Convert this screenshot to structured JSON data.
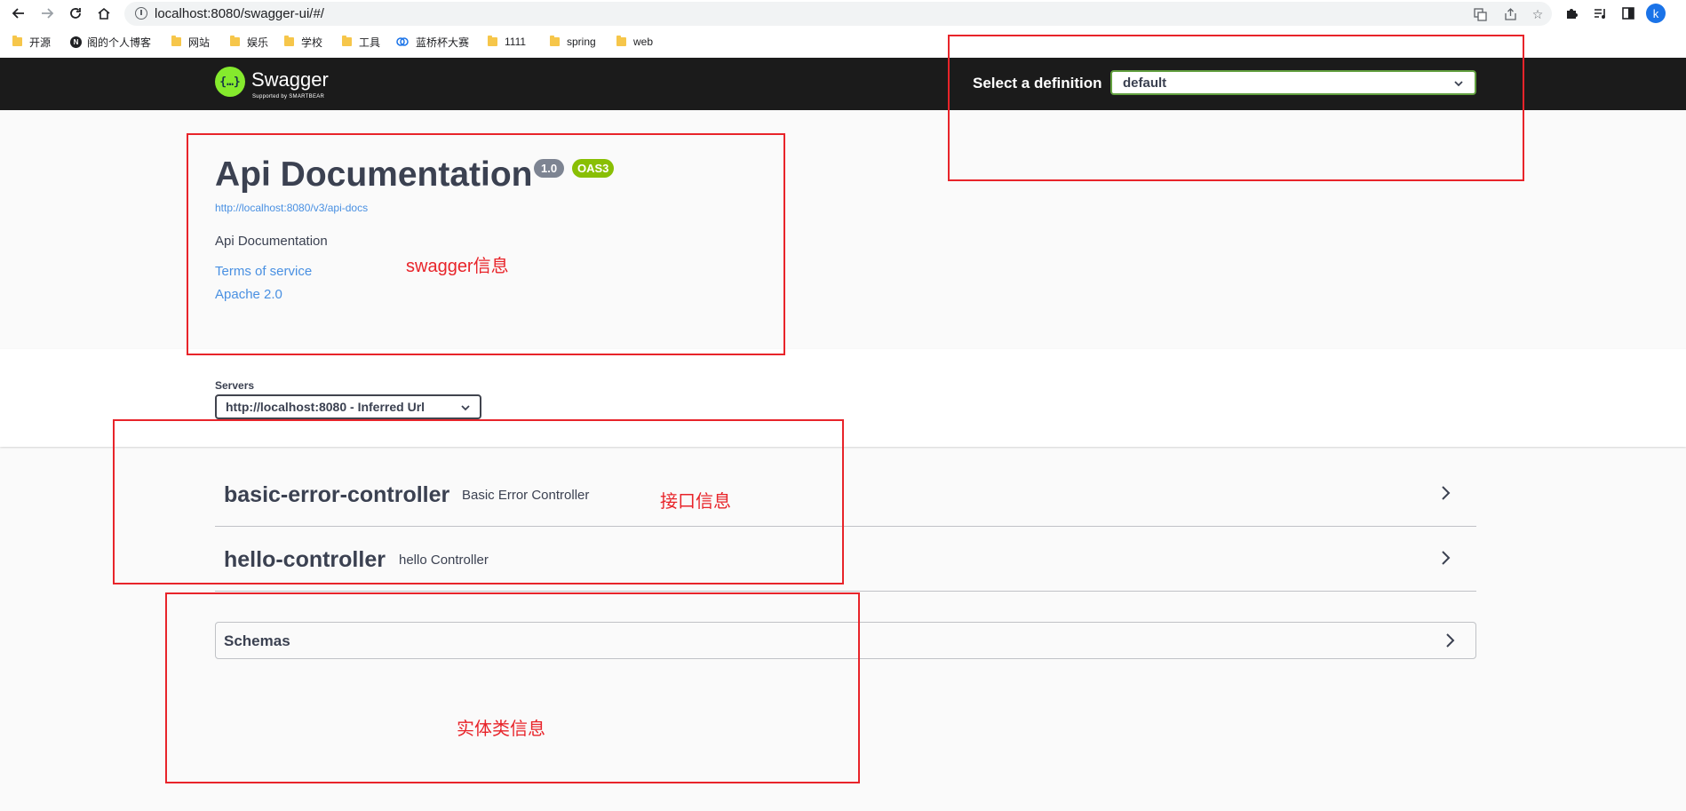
{
  "browser": {
    "url": "localhost:8080/swagger-ui/#/",
    "profile_initial": "k",
    "bookmarks": [
      "开源",
      "阁的个人博客",
      "网站",
      "娱乐",
      "学校",
      "工具",
      "蓝桥杯大赛",
      "1111",
      "spring",
      "web"
    ]
  },
  "topbar": {
    "logo_name": "Swagger",
    "logo_sub": "Supported by SMARTBEAR",
    "definition_label": "Select a definition",
    "definition_value": "default"
  },
  "info": {
    "title": "Api Documentation",
    "version": "1.0",
    "oas": "OAS3",
    "docs_url": "http://localhost:8080/v3/api-docs",
    "description": "Api Documentation",
    "terms": "Terms of service",
    "license": "Apache 2.0"
  },
  "servers": {
    "label": "Servers",
    "selected": "http://localhost:8080 - Inferred Url"
  },
  "tags": [
    {
      "name": "basic-error-controller",
      "description": "Basic Error Controller"
    },
    {
      "name": "hello-controller",
      "description": "hello Controller"
    }
  ],
  "schemas": {
    "title": "Schemas"
  },
  "annotations": {
    "swagger_info": "swagger信息",
    "api_info": "接口信息",
    "entity_info": "实体类信息"
  },
  "colors": {
    "topbar": "#1b1b1b",
    "swagger_green": "#85ea2d",
    "definition_border": "#62a03f",
    "oas_badge": "#89bf04",
    "version_badge": "#7d8492",
    "link": "#4990e2",
    "annotation_red": "#e8242a"
  }
}
